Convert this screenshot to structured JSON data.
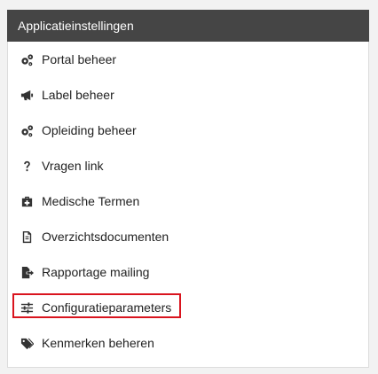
{
  "header": {
    "title": "Applicatieinstellingen"
  },
  "menu": {
    "items": [
      {
        "label": "Portal beheer",
        "icon": "cogs-icon"
      },
      {
        "label": "Label beheer",
        "icon": "megaphone-icon"
      },
      {
        "label": "Opleiding beheer",
        "icon": "cogs-icon"
      },
      {
        "label": "Vragen link",
        "icon": "question-icon"
      },
      {
        "label": "Medische Termen",
        "icon": "medical-kit-icon"
      },
      {
        "label": "Overzichtsdocumenten",
        "icon": "document-icon"
      },
      {
        "label": "Rapportage mailing",
        "icon": "file-export-icon"
      },
      {
        "label": "Configuratieparameters",
        "icon": "sliders-icon",
        "highlighted": true
      },
      {
        "label": "Kenmerken beheren",
        "icon": "tags-icon"
      }
    ]
  },
  "colors": {
    "header_bg": "#454545",
    "highlight_border": "#d9141e"
  }
}
